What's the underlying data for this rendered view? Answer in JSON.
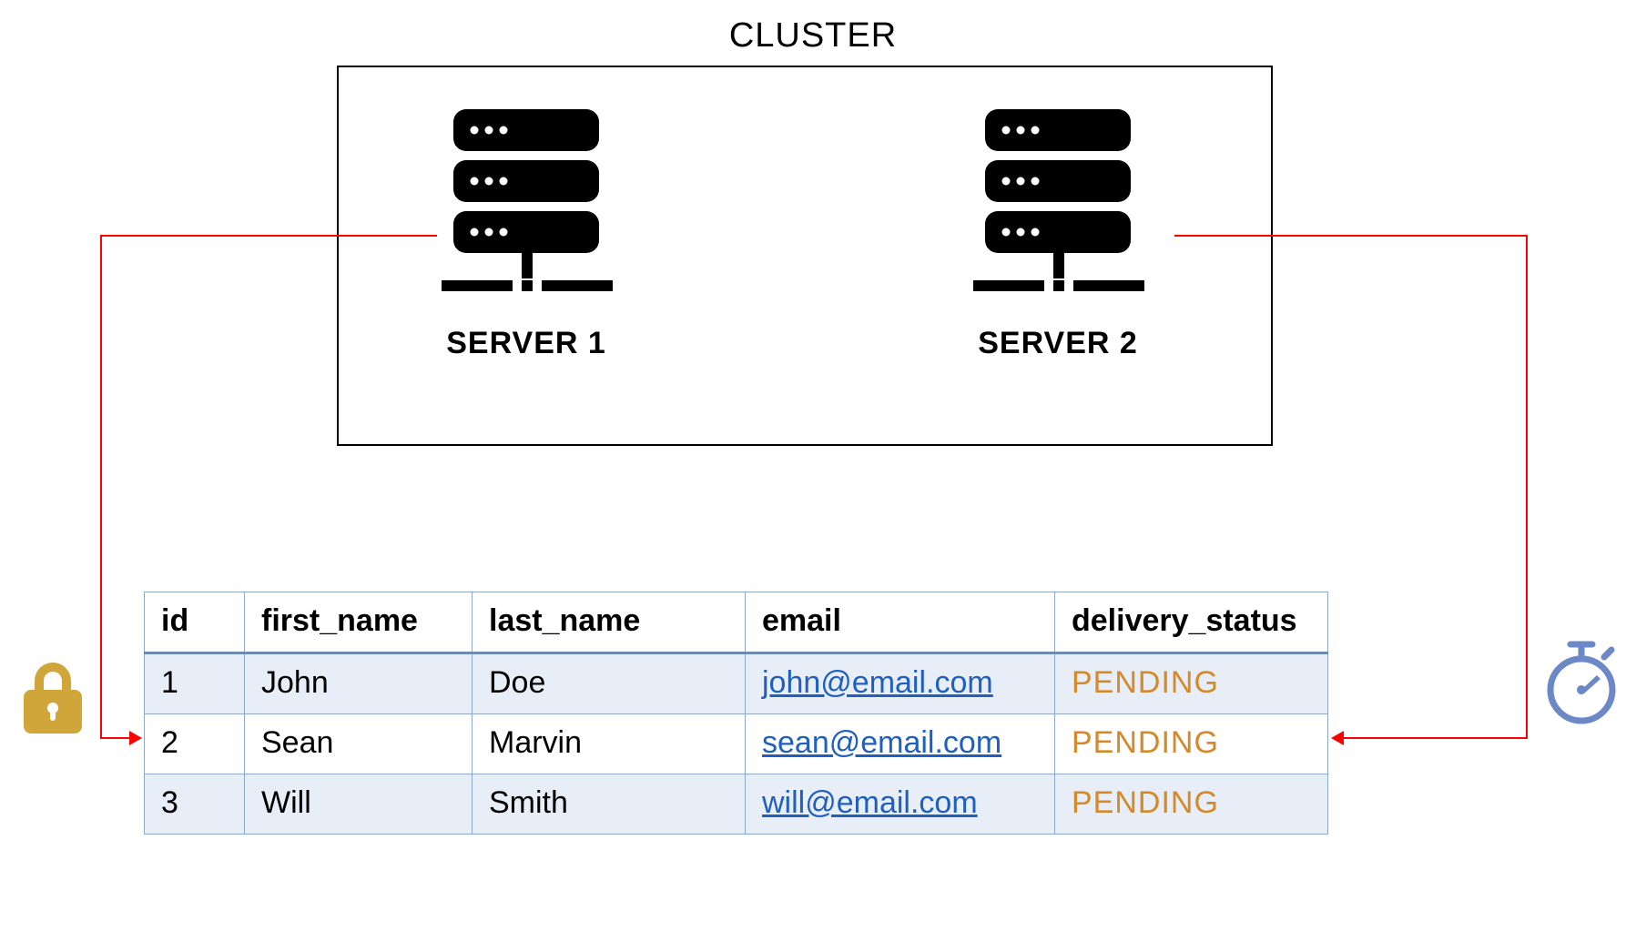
{
  "cluster": {
    "title": "CLUSTER",
    "servers": [
      {
        "label": "SERVER 1"
      },
      {
        "label": "SERVER 2"
      }
    ]
  },
  "icons": {
    "lock": "lock-icon",
    "stopwatch": "stopwatch-icon",
    "server": "server-icon"
  },
  "colors": {
    "connector": "#ff0000",
    "lock": "#d0a539",
    "stopwatch": "#6d88c7",
    "table_border": "#8fa9c9",
    "table_zebra": "#e8eef7",
    "link": "#1f5fbf",
    "pending": "#d48a2a"
  },
  "table": {
    "headers": {
      "id": "id",
      "first_name": "first_name",
      "last_name": "last_name",
      "email": "email",
      "delivery_status": "delivery_status"
    },
    "rows": [
      {
        "id": "1",
        "first_name": "John",
        "last_name": "Doe",
        "email": "john@email.com",
        "delivery_status": "PENDING"
      },
      {
        "id": "2",
        "first_name": "Sean",
        "last_name": "Marvin",
        "email": "sean@email.com",
        "delivery_status": "PENDING"
      },
      {
        "id": "3",
        "first_name": "Will",
        "last_name": "Smith",
        "email": "will@email.com",
        "delivery_status": "PENDING"
      }
    ]
  }
}
